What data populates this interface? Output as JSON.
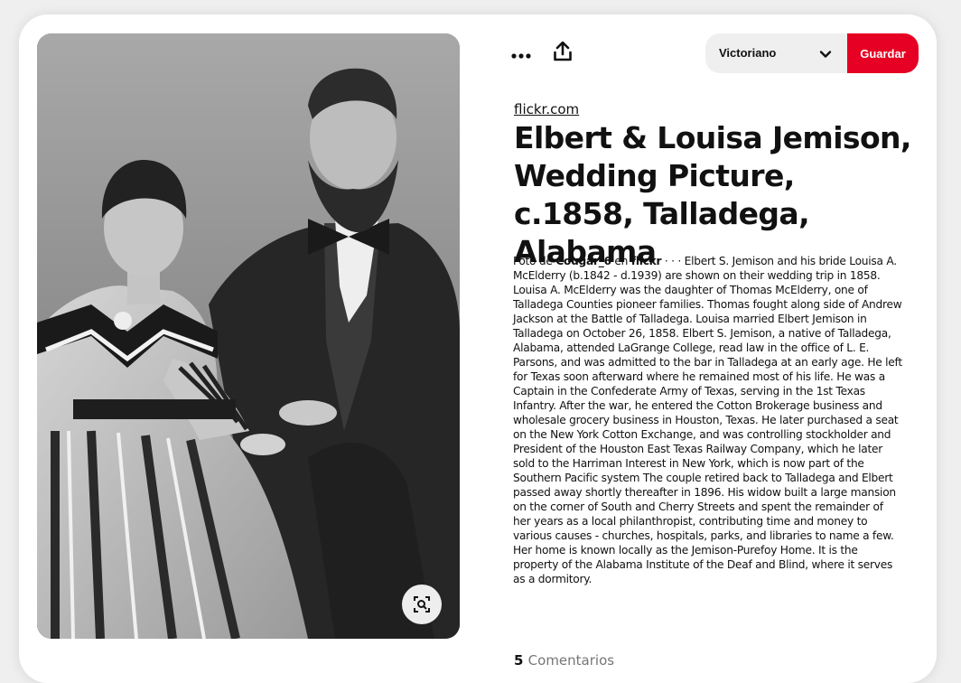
{
  "toolbar": {
    "more_icon": "ellipsis-icon",
    "share_icon": "share-upload-icon",
    "board_select": {
      "selected": "Victoriano"
    },
    "save_label": "Guardar",
    "save_color": "#e60023"
  },
  "image": {
    "lens_icon": "visual-search-icon"
  },
  "pin": {
    "source": "flickr.com",
    "title": "Elbert & Louisa Jemison, Wedding Picture, c.1858, Talladega, Alabama",
    "attribution": {
      "prefix": "Foto de",
      "author": "Cougar_6",
      "conjunction": "en",
      "site": "flickr",
      "separator": "· · ·"
    },
    "description": "Elbert S. Jemison and his bride Louisa A. McElderry (b.1842 - d.1939) are shown on their wedding trip in 1858. Louisa A. McElderry was the daughter of Thomas McElderry, one of Talladega Counties pioneer families. Thomas fought along side of Andrew Jackson at the Battle of Talladega. Louisa married Elbert Jemison in Talladega on October 26, 1858. Elbert S. Jemison, a native of Talladega, Alabama, attended LaGrange College, read law in the office of L. E. Parsons, and was admitted to the bar in Talladega at an early age. He left for Texas soon afterward where he remained most of his life. He was a Captain in the Confederate Army of Texas, serving in the 1st Texas Infantry. After the war, he entered the Cotton Brokerage business and wholesale grocery business in Houston, Texas. He later purchased a seat on the New York Cotton Exchange, and was controlling stockholder and President of the Houston East Texas Railway Company, which he later sold to the Harriman Interest in New York, which is now part of the Southern Pacific system The couple retired back to Talladega and Elbert passed away shortly thereafter in 1896. His widow built a large mansion on the corner of South and Cherry Streets and spent the remainder of her years as a local philanthropist, contributing time and money to various causes - churches, hospitals, parks, and libraries to name a few. Her home is known locally as the Jemison-Purefoy Home. It is the property of the Alabama Institute of the Deaf and Blind, where it serves as a dormitory."
  },
  "comments": {
    "count": "5",
    "label": "Comentarios"
  }
}
